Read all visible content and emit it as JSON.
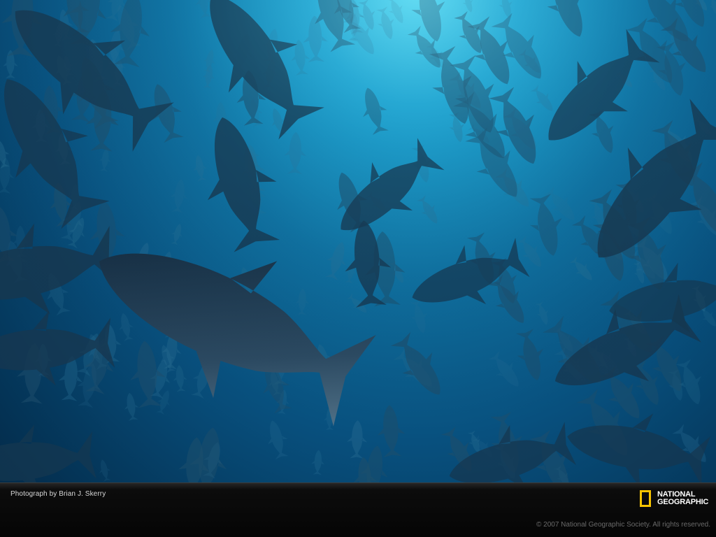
{
  "photo": {
    "subject": "school of bluefin tuna underwater",
    "water_colors": [
      "#4fd6f0",
      "#1fa2cf",
      "#0f6f9f",
      "#08507e",
      "#032b4a"
    ],
    "fish_color": "#1b3d57"
  },
  "footer": {
    "credit": "Photograph by Brian J. Skerry",
    "copyright": "© 2007 National Geographic Society. All rights reserved.",
    "logo": {
      "line1": "NATIONAL",
      "line2": "GEOGRAPHIC",
      "frame_color": "#f7c400",
      "icon": "yellow-rectangle-icon"
    }
  }
}
